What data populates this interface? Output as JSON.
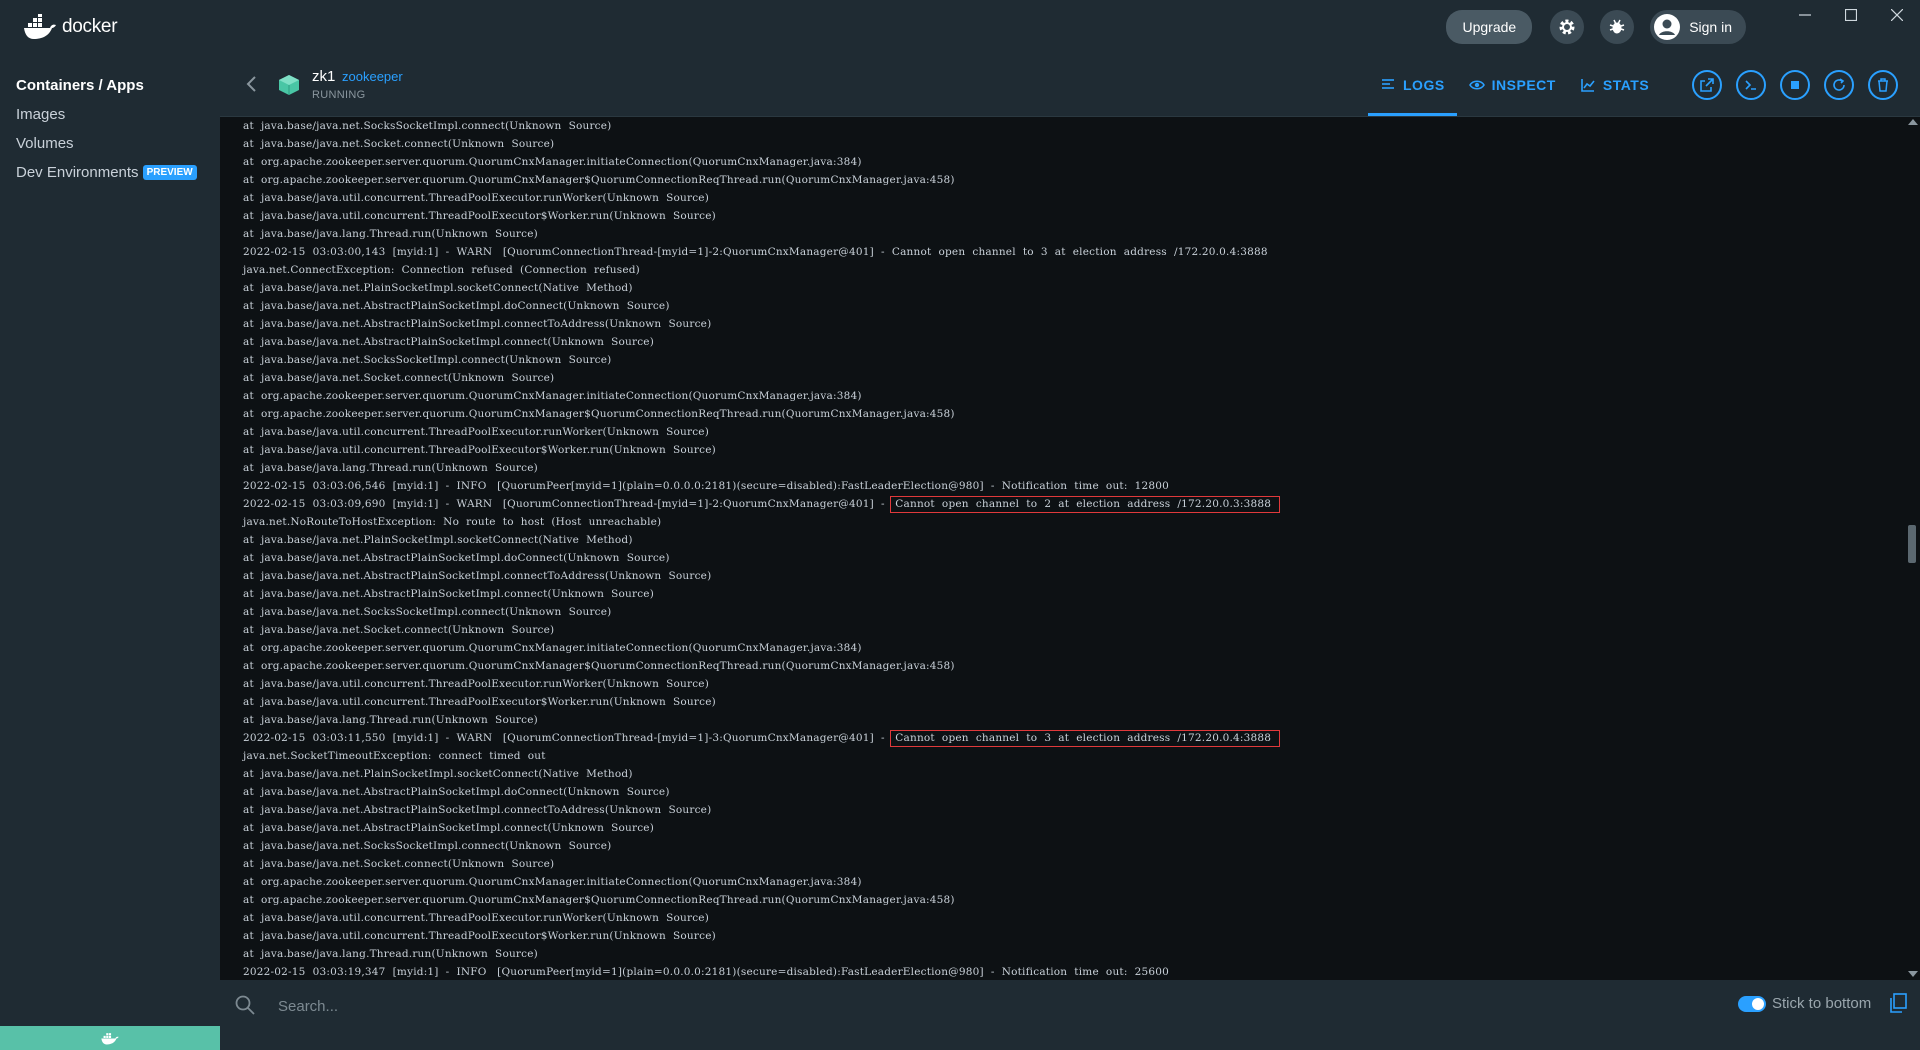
{
  "app": {
    "brand": "docker"
  },
  "titlebar": {
    "upgrade_label": "Upgrade",
    "signin_label": "Sign in"
  },
  "sidebar": {
    "items": [
      {
        "label": "Containers / Apps",
        "active": true
      },
      {
        "label": "Images"
      },
      {
        "label": "Volumes"
      },
      {
        "label": "Dev Environments",
        "badge": "PREVIEW"
      }
    ]
  },
  "container": {
    "name": "zk1",
    "image": "zookeeper",
    "status": "RUNNING"
  },
  "tabs": [
    {
      "label": "LOGS",
      "icon": "list-icon",
      "active": true
    },
    {
      "label": "INSPECT",
      "icon": "eye-icon"
    },
    {
      "label": "STATS",
      "icon": "chart-icon"
    }
  ],
  "logs": {
    "lines": [
      {
        "text": "at  java.base/java.net.SocksSocketImpl.connect(Unknown  Source)"
      },
      {
        "text": "at  java.base/java.net.Socket.connect(Unknown  Source)"
      },
      {
        "text": "at  org.apache.zookeeper.server.quorum.QuorumCnxManager.initiateConnection(QuorumCnxManager.java:384)"
      },
      {
        "text": "at  org.apache.zookeeper.server.quorum.QuorumCnxManager$QuorumConnectionReqThread.run(QuorumCnxManager.java:458)"
      },
      {
        "text": "at  java.base/java.util.concurrent.ThreadPoolExecutor.runWorker(Unknown  Source)"
      },
      {
        "text": "at  java.base/java.util.concurrent.ThreadPoolExecutor$Worker.run(Unknown  Source)"
      },
      {
        "text": "at  java.base/java.lang.Thread.run(Unknown  Source)"
      },
      {
        "text": "2022-02-15  03:03:00,143  [myid:1]  -  WARN   [QuorumConnectionThread-[myid=1]-2:QuorumCnxManager@401]  -  Cannot  open  channel  to  3  at  election  address  /172.20.0.4:3888"
      },
      {
        "text": "java.net.ConnectException:  Connection  refused  (Connection  refused)"
      },
      {
        "text": "at  java.base/java.net.PlainSocketImpl.socketConnect(Native  Method)"
      },
      {
        "text": "at  java.base/java.net.AbstractPlainSocketImpl.doConnect(Unknown  Source)"
      },
      {
        "text": "at  java.base/java.net.AbstractPlainSocketImpl.connectToAddress(Unknown  Source)"
      },
      {
        "text": "at  java.base/java.net.AbstractPlainSocketImpl.connect(Unknown  Source)"
      },
      {
        "text": "at  java.base/java.net.SocksSocketImpl.connect(Unknown  Source)"
      },
      {
        "text": "at  java.base/java.net.Socket.connect(Unknown  Source)"
      },
      {
        "text": "at  org.apache.zookeeper.server.quorum.QuorumCnxManager.initiateConnection(QuorumCnxManager.java:384)"
      },
      {
        "text": "at  org.apache.zookeeper.server.quorum.QuorumCnxManager$QuorumConnectionReqThread.run(QuorumCnxManager.java:458)"
      },
      {
        "text": "at  java.base/java.util.concurrent.ThreadPoolExecutor.runWorker(Unknown  Source)"
      },
      {
        "text": "at  java.base/java.util.concurrent.ThreadPoolExecutor$Worker.run(Unknown  Source)"
      },
      {
        "text": "at  java.base/java.lang.Thread.run(Unknown  Source)"
      },
      {
        "text": "2022-02-15  03:03:06,546  [myid:1]  -  INFO   [QuorumPeer[myid=1](plain=0.0.0.0:2181)(secure=disabled):FastLeaderElection@980]  -  Notification  time  out:  12800"
      },
      {
        "text": "2022-02-15  03:03:09,690  [myid:1]  -  WARN   [QuorumConnectionThread-[myid=1]-2:QuorumCnxManager@401]  - ",
        "highlight": "Cannot  open  channel  to  2  at  election  address  /172.20.0.3:3888"
      },
      {
        "text": "java.net.NoRouteToHostException:  No  route  to  host  (Host  unreachable)"
      },
      {
        "text": "at  java.base/java.net.PlainSocketImpl.socketConnect(Native  Method)"
      },
      {
        "text": "at  java.base/java.net.AbstractPlainSocketImpl.doConnect(Unknown  Source)"
      },
      {
        "text": "at  java.base/java.net.AbstractPlainSocketImpl.connectToAddress(Unknown  Source)"
      },
      {
        "text": "at  java.base/java.net.AbstractPlainSocketImpl.connect(Unknown  Source)"
      },
      {
        "text": "at  java.base/java.net.SocksSocketImpl.connect(Unknown  Source)"
      },
      {
        "text": "at  java.base/java.net.Socket.connect(Unknown  Source)"
      },
      {
        "text": "at  org.apache.zookeeper.server.quorum.QuorumCnxManager.initiateConnection(QuorumCnxManager.java:384)"
      },
      {
        "text": "at  org.apache.zookeeper.server.quorum.QuorumCnxManager$QuorumConnectionReqThread.run(QuorumCnxManager.java:458)"
      },
      {
        "text": "at  java.base/java.util.concurrent.ThreadPoolExecutor.runWorker(Unknown  Source)"
      },
      {
        "text": "at  java.base/java.util.concurrent.ThreadPoolExecutor$Worker.run(Unknown  Source)"
      },
      {
        "text": "at  java.base/java.lang.Thread.run(Unknown  Source)"
      },
      {
        "text": "2022-02-15  03:03:11,550  [myid:1]  -  WARN   [QuorumConnectionThread-[myid=1]-3:QuorumCnxManager@401]  - ",
        "highlight": "Cannot  open  channel  to  3  at  election  address  /172.20.0.4:3888"
      },
      {
        "text": "java.net.SocketTimeoutException:  connect  timed  out"
      },
      {
        "text": "at  java.base/java.net.PlainSocketImpl.socketConnect(Native  Method)"
      },
      {
        "text": "at  java.base/java.net.AbstractPlainSocketImpl.doConnect(Unknown  Source)"
      },
      {
        "text": "at  java.base/java.net.AbstractPlainSocketImpl.connectToAddress(Unknown  Source)"
      },
      {
        "text": "at  java.base/java.net.AbstractPlainSocketImpl.connect(Unknown  Source)"
      },
      {
        "text": "at  java.base/java.net.SocksSocketImpl.connect(Unknown  Source)"
      },
      {
        "text": "at  java.base/java.net.Socket.connect(Unknown  Source)"
      },
      {
        "text": "at  org.apache.zookeeper.server.quorum.QuorumCnxManager.initiateConnection(QuorumCnxManager.java:384)"
      },
      {
        "text": "at  org.apache.zookeeper.server.quorum.QuorumCnxManager$QuorumConnectionReqThread.run(QuorumCnxManager.java:458)"
      },
      {
        "text": "at  java.base/java.util.concurrent.ThreadPoolExecutor.runWorker(Unknown  Source)"
      },
      {
        "text": "at  java.base/java.util.concurrent.ThreadPoolExecutor$Worker.run(Unknown  Source)"
      },
      {
        "text": "at  java.base/java.lang.Thread.run(Unknown  Source)"
      },
      {
        "text": "2022-02-15  03:03:19,347  [myid:1]  -  INFO   [QuorumPeer[myid=1](plain=0.0.0.0:2181)(secure=disabled):FastLeaderElection@980]  -  Notification  time  out:  25600"
      }
    ]
  },
  "search": {
    "placeholder": "Search..."
  },
  "stick": {
    "label": "Stick to bottom",
    "enabled": true
  },
  "colors": {
    "accent": "#2aa0ff",
    "highlight_border": "#e0393b",
    "sidebar_bg": "#1f2b33",
    "log_bg": "#0d1114"
  }
}
